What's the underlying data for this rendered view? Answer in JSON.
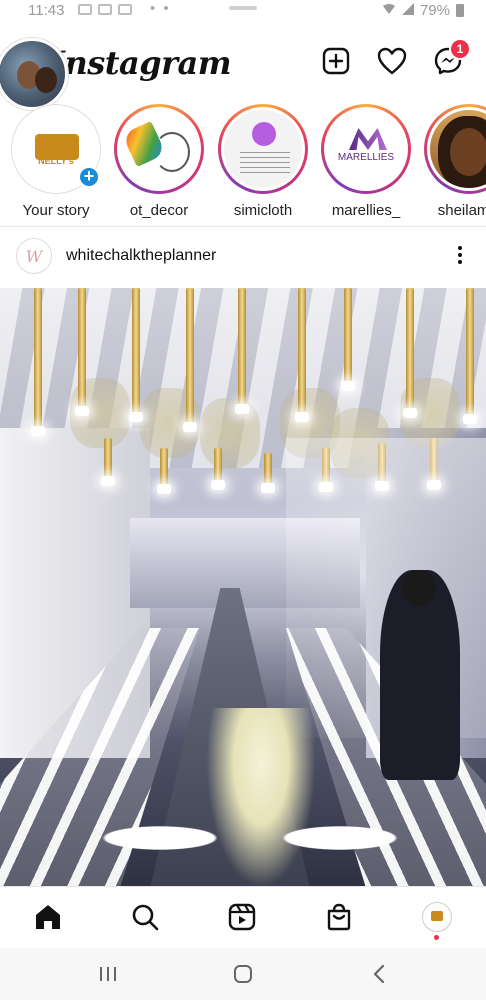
{
  "status_bar": {
    "time": "11:43",
    "battery": "79%"
  },
  "header": {
    "logo": "Instagram",
    "notification_count": "1"
  },
  "stories": [
    {
      "label": "Your story",
      "pic": "nelly"
    },
    {
      "label": "ot_decor",
      "pic": "decor"
    },
    {
      "label": "simicloth",
      "pic": "simi"
    },
    {
      "label": "marellies_",
      "pic": "marellies"
    },
    {
      "label": "sheilamw",
      "pic": "sheila"
    }
  ],
  "story_pic_text": {
    "nelly": "NELLY's",
    "marellies": "MARELLIES"
  },
  "post": {
    "username": "whitechalktheplanner",
    "avatar_initials": "W"
  },
  "nav": {
    "items": [
      "home",
      "search",
      "reels",
      "shop",
      "profile"
    ]
  },
  "colors": {
    "badge": "#ed2f4a",
    "add_story": "#1a8cd8",
    "gold": "#c98a1b"
  }
}
